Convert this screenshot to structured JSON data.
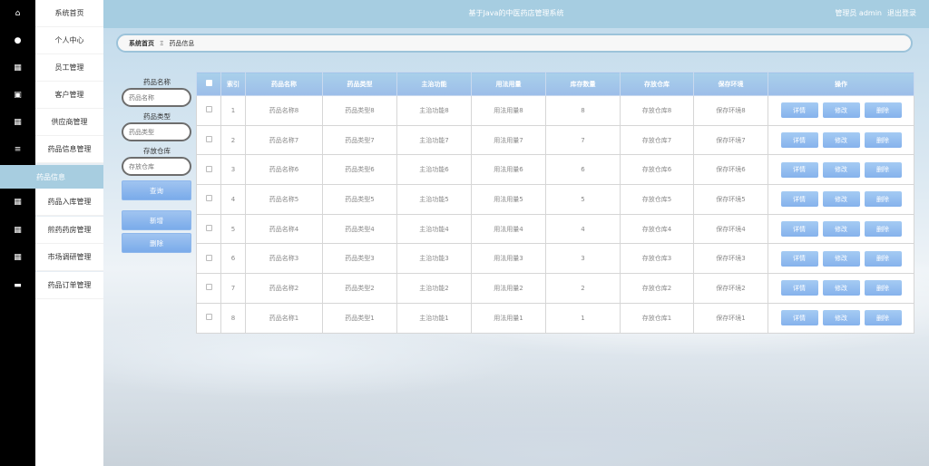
{
  "header": {
    "title": "基于Java的中医药店管理系统",
    "user": "管理员 admin",
    "logout": "退出登录"
  },
  "sidebar": {
    "items": [
      {
        "label": "系统首页",
        "icon": "home-icon"
      },
      {
        "label": "个人中心",
        "icon": "user-icon"
      },
      {
        "label": "员工管理",
        "icon": "grid-icon"
      },
      {
        "label": "客户管理",
        "icon": "clipboard-icon"
      },
      {
        "label": "供应商管理",
        "icon": "grid-icon"
      },
      {
        "label": "药品信息管理",
        "icon": "list-icon"
      }
    ],
    "active_sub": "药品信息",
    "items2": [
      {
        "label": "药品入库管理",
        "icon": "grid-icon"
      },
      {
        "label": "煎药药房管理",
        "icon": "grid-icon"
      },
      {
        "label": "市场调研管理",
        "icon": "grid-icon"
      },
      {
        "label": "药品订单管理",
        "icon": "monitor-icon"
      }
    ]
  },
  "breadcrumb": {
    "home": "系统首页",
    "sep": "Ξ",
    "current": "药品信息"
  },
  "search": {
    "name_label": "药品名称",
    "name_placeholder": "药品名称",
    "type_label": "药品类型",
    "type_placeholder": "药品类型",
    "warehouse_label": "存放仓库",
    "warehouse_placeholder": "存放仓库",
    "query": "查询",
    "add": "新增",
    "delete": "删除"
  },
  "table": {
    "columns": [
      "索引",
      "药品名称",
      "药品类型",
      "主治功能",
      "用法用量",
      "库存数量",
      "存放仓库",
      "保存环境",
      "操作"
    ],
    "actions": {
      "detail": "详情",
      "edit": "修改",
      "delete": "删除"
    },
    "rows": [
      {
        "idx": "1",
        "name": "药品名称8",
        "type": "药品类型8",
        "func": "主治功能8",
        "usage": "用法用量8",
        "stock": "8",
        "warehouse": "存放仓库8",
        "env": "保存环境8"
      },
      {
        "idx": "2",
        "name": "药品名称7",
        "type": "药品类型7",
        "func": "主治功能7",
        "usage": "用法用量7",
        "stock": "7",
        "warehouse": "存放仓库7",
        "env": "保存环境7"
      },
      {
        "idx": "3",
        "name": "药品名称6",
        "type": "药品类型6",
        "func": "主治功能6",
        "usage": "用法用量6",
        "stock": "6",
        "warehouse": "存放仓库6",
        "env": "保存环境6"
      },
      {
        "idx": "4",
        "name": "药品名称5",
        "type": "药品类型5",
        "func": "主治功能5",
        "usage": "用法用量5",
        "stock": "5",
        "warehouse": "存放仓库5",
        "env": "保存环境5"
      },
      {
        "idx": "5",
        "name": "药品名称4",
        "type": "药品类型4",
        "func": "主治功能4",
        "usage": "用法用量4",
        "stock": "4",
        "warehouse": "存放仓库4",
        "env": "保存环境4"
      },
      {
        "idx": "6",
        "name": "药品名称3",
        "type": "药品类型3",
        "func": "主治功能3",
        "usage": "用法用量3",
        "stock": "3",
        "warehouse": "存放仓库3",
        "env": "保存环境3"
      },
      {
        "idx": "7",
        "name": "药品名称2",
        "type": "药品类型2",
        "func": "主治功能2",
        "usage": "用法用量2",
        "stock": "2",
        "warehouse": "存放仓库2",
        "env": "保存环境2"
      },
      {
        "idx": "8",
        "name": "药品名称1",
        "type": "药品类型1",
        "func": "主治功能1",
        "usage": "用法用量1",
        "stock": "1",
        "warehouse": "存放仓库1",
        "env": "保存环境1"
      }
    ]
  },
  "colors": {
    "header": "#a6cde1",
    "accent": "#85b2ec",
    "rail": "#000000"
  }
}
